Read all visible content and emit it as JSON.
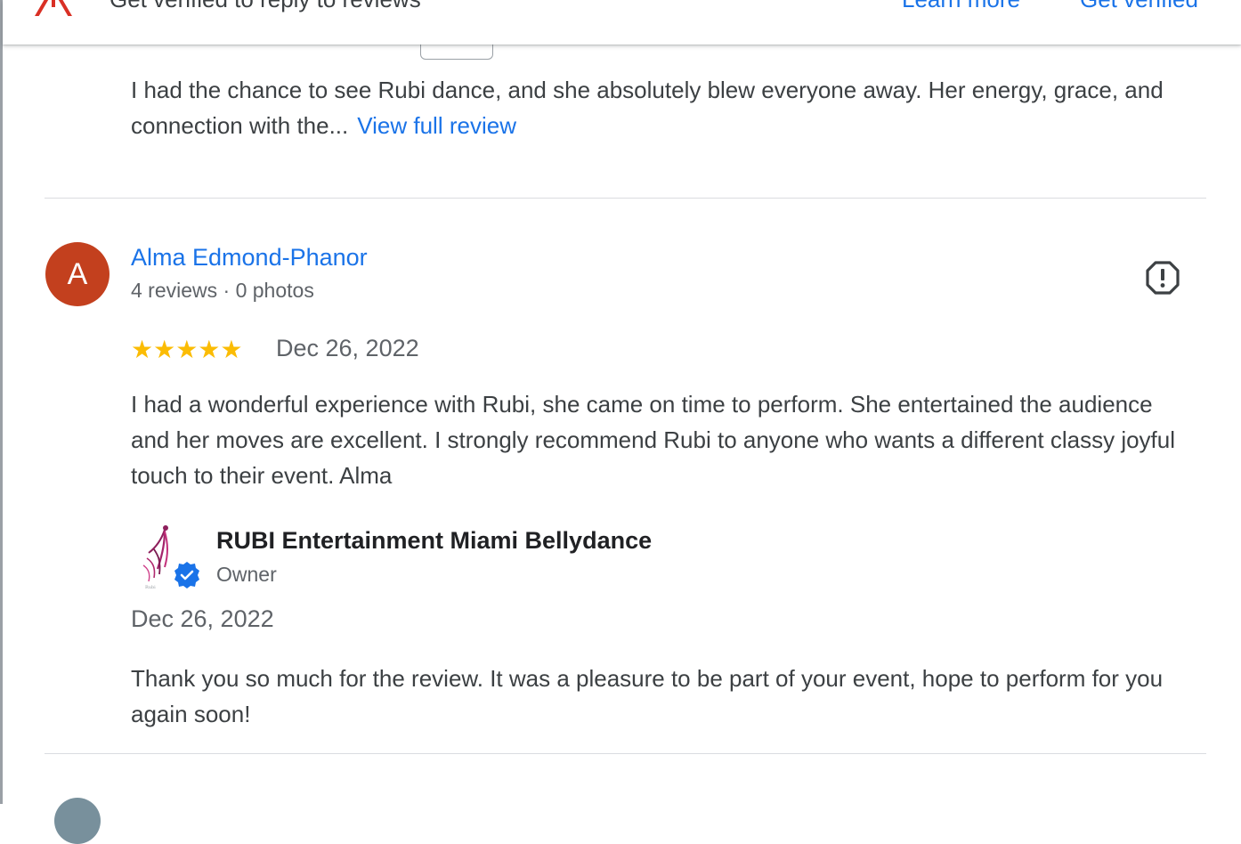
{
  "banner": {
    "notice": "Get verified to reply to reviews",
    "learn_more": "Learn more",
    "get_verified": "Get verified"
  },
  "previous_review": {
    "text": "I had the chance to see Rubi dance, and she absolutely blew everyone away. Her energy, grace, and connection with the...",
    "view_full": "View full review"
  },
  "review": {
    "avatar_letter": "A",
    "avatar_color": "#c3401e",
    "name": "Alma Edmond-Phanor",
    "meta": "4 reviews · 0 photos",
    "stars": "★★★★★",
    "date": "Dec 26, 2022",
    "text": "I had a wonderful experience with Rubi, she came on time to perform. She entertained the audience and her moves are excellent. I strongly recommend Rubi to anyone who wants a different classy joyful touch to their event. Alma",
    "report_icon": "flag-report-icon"
  },
  "owner_reply": {
    "name": "RUBI Entertainment Miami Bellydance",
    "role": "Owner",
    "date": "Dec 26, 2022",
    "text": "Thank you so much for the review. It was a pleasure to be part of your event, hope to perform for you again soon!",
    "verified_icon": "verified-badge-icon"
  },
  "colors": {
    "link": "#1a73e8",
    "star": "#fbbc04",
    "warning": "#d93025"
  }
}
